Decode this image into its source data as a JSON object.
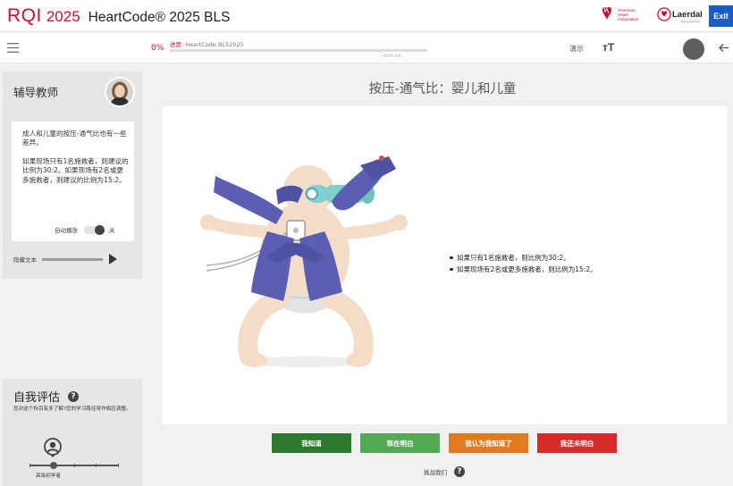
{
  "header": {
    "brand_rqi": "RQI",
    "brand_year": "2025",
    "app_title": "HeartCode® 2025 BLS",
    "aha_logo_text": [
      "American",
      "Heart",
      "Association."
    ],
    "laerdal_logo_text": "Laerdal",
    "laerdal_tagline": "helping save lives",
    "exit_label": "Exit",
    "brand_color": "#c8102e"
  },
  "toolbar": {
    "menu_icon": "hamburger-menu-icon",
    "progress_percent": "0%",
    "progress_value": 0,
    "progress_prefix": "进度:",
    "progress_course": "HeartCode BLS2025",
    "progress_time": "~67m left",
    "demo_label": "演示",
    "text_size_label": "тT",
    "back_icon": "arrow-left-icon"
  },
  "tutor": {
    "title": "辅导教师",
    "paragraph1": "成人和儿童的按压-通气比也有一些差异。",
    "paragraph2": "如果现场只有1名施救者，则建议的比例为30:2。如果现场有2名或更多施救者，则建议的比例为15:2。",
    "autoplay_label": "自动播放",
    "autoplay_state": "关",
    "captions_label": "隐藏文本"
  },
  "self_assessment": {
    "title": "自我评估",
    "description": "您对这个科目有多了解?您的学习路径将作相应调整。",
    "level_label": "高级初学者",
    "level_value": 0.25
  },
  "main": {
    "title": "按压-通气比：婴儿和儿童",
    "bullets": [
      "如果只有1名施救者，则比例为30:2。",
      "如果现场有2名或更多施救者，则比例为15:2。"
    ]
  },
  "answers": {
    "know": "我知道",
    "now": "现在明白",
    "think": "我认为我知道了",
    "notyet": "我还未明白",
    "colors": {
      "know": "#2e7a2e",
      "now": "#54a957",
      "think": "#e27a1f",
      "notyet": "#d62b2b"
    }
  },
  "challenge": {
    "label": "挑战我们"
  }
}
